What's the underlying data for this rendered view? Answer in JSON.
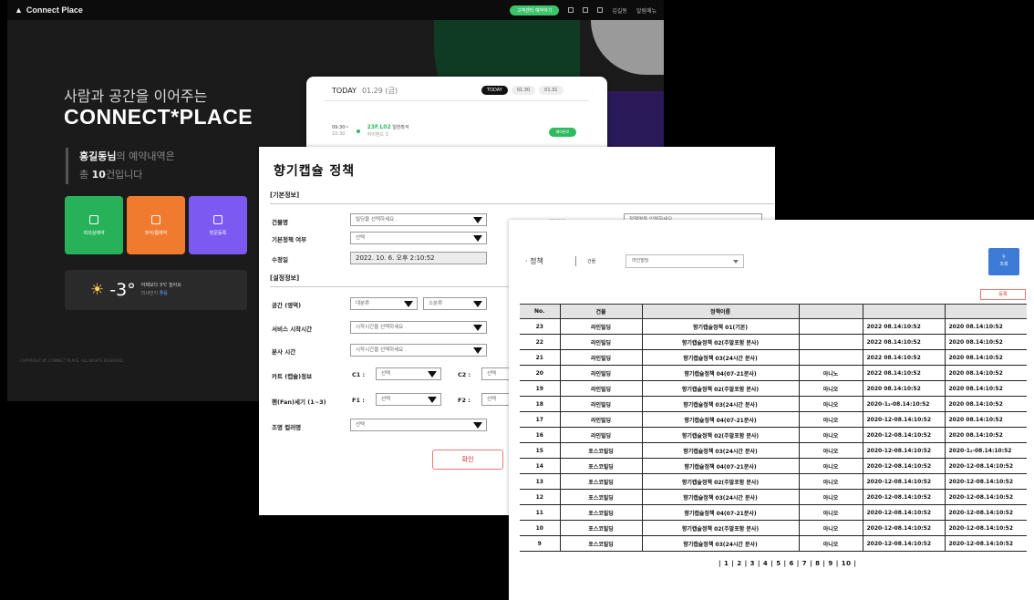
{
  "dark_app": {
    "brand": "Connect Place",
    "topbar_pill": "고객센터 예약하기",
    "topbar_user": "김길동",
    "topbar_menu": "알림메뉴",
    "hero_sub": "사람과 공간을 이어주는",
    "hero_title": "CONNECT*PLACE",
    "reserve_name": "홍길동님",
    "reserve_line1": "의 예약내역은",
    "reserve_pre": "총",
    "reserve_count": "10",
    "reserve_suffix": "건입니다",
    "tiles": [
      "회의실예약",
      "좌석/룸예약",
      "방문등록"
    ],
    "weather_temp": "-3°",
    "weather_desc": "어제보다 3℃ 높아요",
    "weather_sub": "미세먼지",
    "weather_link": "좋음",
    "footer": "COPYRIGHT BY CONNECT PLACE. ALL RIGHTS RESERVED.",
    "today": {
      "label": "TODAY",
      "date": "01.29 (금)",
      "tabs": [
        "TODAY",
        "01.30",
        "01.31"
      ],
      "time": "09:30~",
      "duration": "10:30",
      "room_id": "23F.L02",
      "room_name": "일반좌석",
      "room_sub": "하이엔드 3",
      "status": "예약완료"
    },
    "colors": {
      "tile_green": "#27b25a",
      "tile_orange": "#f07a2e",
      "tile_purple": "#7c5af2",
      "accent_green": "#2dbb5e"
    }
  },
  "policy_form": {
    "title": "향기캡슐 정책",
    "section_basic": "[기본정보]",
    "section_setting": "[설정정보]",
    "building_label": "건물명",
    "building_ph": "빌딩을 선택하세요 .",
    "default_label": "기본정책 여부",
    "default_value": "선택",
    "modified_label": "수정일",
    "modified_value": "2022. 10. 6. 오후 2:10:52",
    "policy_name_label": "정책명",
    "policy_name_ph": "정책명을 입력하세요",
    "space_label": "공간 (영역)",
    "space_value1": "대분류",
    "space_value2": "소분류",
    "start_label": "서비스 시작시간",
    "start_ph": "시작시간을 선택하세요 .",
    "run_label": "분사 시간",
    "run_ph": "시작시간을 선택하세요 .",
    "cartridge_label": "카트 (캡슐)정보",
    "c1_label": "C1 :",
    "c1_value": "선택",
    "c2_label": "C2 :",
    "c2_value": "선택",
    "fan_label": "팬(Fan)세기 (1~3)",
    "f1_label": "F1 :",
    "f1_value": "선택",
    "f2_label": "F2 :",
    "f2_value": "선택",
    "light_label": "조명 컬러명",
    "light_value": "선택",
    "confirm": "확인"
  },
  "policy_list": {
    "title": "· 정책",
    "filter_label": "건물",
    "filter_value": "라인빌딩",
    "query_btn": "조회",
    "save_btn": "등록",
    "columns": [
      "No.",
      "건물",
      "정책이름",
      "",
      "",
      ""
    ],
    "rows": [
      [
        "23",
        "라인빌딩",
        "향기캡슐정책 01(기본)",
        "",
        "2022  08.14:10:52",
        "2020  08.14:10:52"
      ],
      [
        "22",
        "라인빌딩",
        "향기캡슐정책 02(주말포함  분사)",
        "",
        "2022  08.14:10:52",
        "2020  08.14:10:52"
      ],
      [
        "21",
        "라인빌딩",
        "향기캡슐정책 03(24시간  분사)",
        "",
        "2022  08.14:10:52",
        "2020  08.14:10:52"
      ],
      [
        "20",
        "라인빌딩",
        "향기캡슐정책 04(07-21분사)",
        "아니노",
        "2022  08.14:10:52",
        "2020  08.14:10:52"
      ],
      [
        "19",
        "라인빌딩",
        "향기캡슐정책 02(주말포함  분사)",
        "아니오",
        "2020  08.14:10:52",
        "2020  08.14:10:52"
      ],
      [
        "18",
        "라인빌딩",
        "향기캡슐정책 03(24시간  분사)",
        "아니오",
        "2020-1₂-08.14:10:52",
        "2020  08.14:10:52"
      ],
      [
        "17",
        "라인빌딩",
        "향기캡슐정책 04(07-21분사)",
        "아니오",
        "2020-12-08.14:10:52",
        "2020  08.14:10:52"
      ],
      [
        "16",
        "라인빌딩",
        "향기캡슐정책 02(주말포함  분사)",
        "아니오",
        "2020-12-08.14:10:52",
        "2020  08.14:10:52"
      ],
      [
        "15",
        "포스코빌딩",
        "향기캡슐정책 03(24시간  분사)",
        "아니오",
        "2020-12-08.14:10:52",
        "2020-1₂-08.14:10:52"
      ],
      [
        "14",
        "포스코빌딩",
        "향기캡슐정책 04(07-21분사)",
        "아니오",
        "2020-12-08.14:10:52",
        "2020-12-08.14:10:52"
      ],
      [
        "13",
        "포스코빌딩",
        "향기캡슐정책 02(주말포함  분사)",
        "아니오",
        "2020-12-08.14:10:52",
        "2020-12-08.14:10:52"
      ],
      [
        "12",
        "포스코빌딩",
        "향기캡슐정책 03(24시간  분사)",
        "아니오",
        "2020-12-08.14:10:52",
        "2020-12-08.14:10:52"
      ],
      [
        "11",
        "포스코빌딩",
        "향기캡슐정책 04(07-21분사)",
        "아니오",
        "2020-12-08.14:10:52",
        "2020-12-08.14:10:52"
      ],
      [
        "10",
        "포스코빌딩",
        "향기캡슐정책 02(주말포함  분사)",
        "아니오",
        "2020-12-08.14:10:52",
        "2020-12-08.14:10:52"
      ],
      [
        "9",
        "포스코빌딩",
        "향기캡슐정책 03(24시간  분사)",
        "아니오",
        "2020-12-08.14:10:52",
        "2020-12-08.14:10:52"
      ]
    ],
    "pagination": "| 1 | 2 | 3 | 4 | 5 | 6 | 7 | 8 | 9 | 10 |"
  }
}
